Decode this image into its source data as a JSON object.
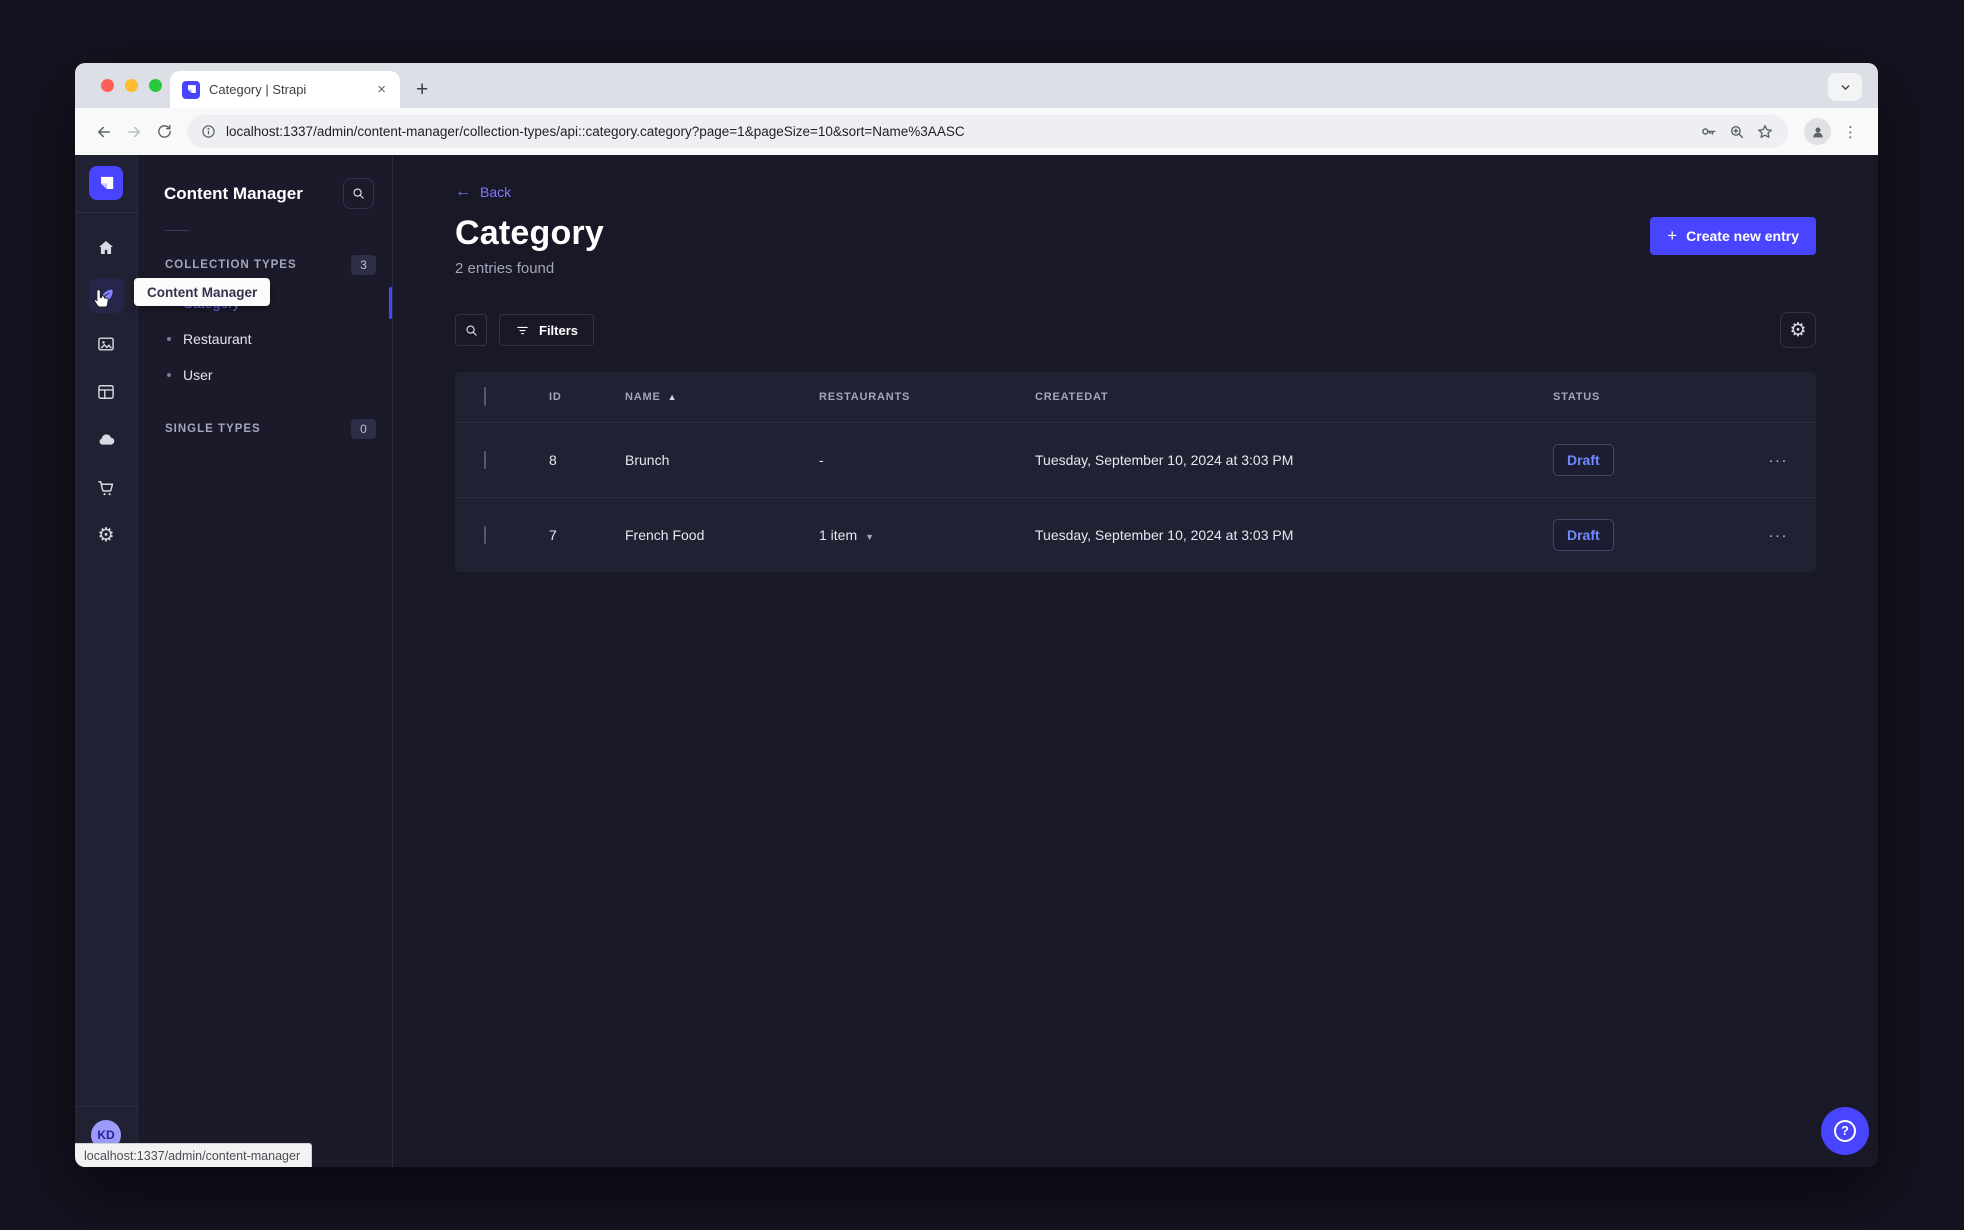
{
  "browser": {
    "tab_title": "Category | Strapi",
    "url": "localhost:1337/admin/content-manager/collection-types/api::category.category?page=1&pageSize=10&sort=Name%3AASC",
    "status_bar": "localhost:1337/admin/content-manager"
  },
  "sidebar": {
    "tooltip": "Content Manager",
    "avatar_initials": "KD",
    "rail_icons": [
      "home-icon",
      "content-manager-icon",
      "media-library-icon",
      "content-type-builder-icon",
      "cloud-icon",
      "marketplace-icon",
      "settings-icon"
    ]
  },
  "subnav": {
    "title": "Content Manager",
    "sections": [
      {
        "label": "COLLECTION TYPES",
        "badge": "3",
        "items": [
          {
            "label": "Category",
            "active": true
          },
          {
            "label": "Restaurant",
            "active": false
          },
          {
            "label": "User",
            "active": false
          }
        ]
      },
      {
        "label": "SINGLE TYPES",
        "badge": "0",
        "items": []
      }
    ]
  },
  "main": {
    "back_label": "Back",
    "title": "Category",
    "subtitle": "2 entries found",
    "create_label": "Create new entry",
    "filters_label": "Filters",
    "table": {
      "headers": [
        "ID",
        "NAME",
        "RESTAURANTS",
        "CREATEDAT",
        "STATUS"
      ],
      "sorted_column": "NAME",
      "sort_direction": "ASC",
      "rows": [
        {
          "id": "8",
          "name": "Brunch",
          "restaurants": "-",
          "created_at": "Tuesday, September 10, 2024 at 3:03 PM",
          "status": "Draft"
        },
        {
          "id": "7",
          "name": "French Food",
          "restaurants": "1 item",
          "created_at": "Tuesday, September 10, 2024 at 3:03 PM",
          "status": "Draft"
        }
      ]
    },
    "row_actions_glyph": "···"
  },
  "colors": {
    "accent": "#4945ff",
    "accent_light": "#7b79ff",
    "draft_text": "#6f8aff",
    "app_background": "#181826",
    "surface": "#212134"
  }
}
